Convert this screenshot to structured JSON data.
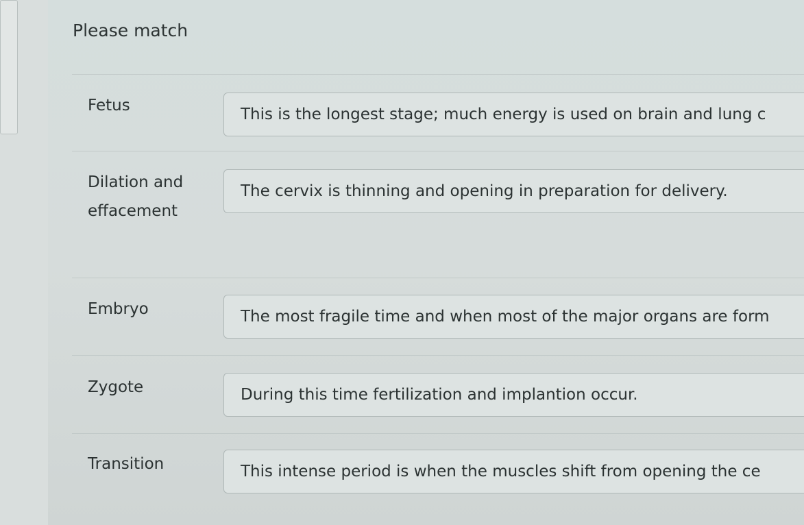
{
  "question": {
    "title": "Please match"
  },
  "pairs": [
    {
      "term": "Fetus",
      "answer": "This is the longest stage; much energy is used on brain and lung c"
    },
    {
      "term": "Dilation and effacement",
      "answer": "The cervix is thinning and opening in preparation for delivery."
    },
    {
      "term": "Embryo",
      "answer": "The most fragile time and when most of the major organs are form"
    },
    {
      "term": "Zygote",
      "answer": "During this time fertilization and implantion occur."
    },
    {
      "term": "Transition",
      "answer": "This intense period is when the muscles shift from opening the ce"
    }
  ]
}
